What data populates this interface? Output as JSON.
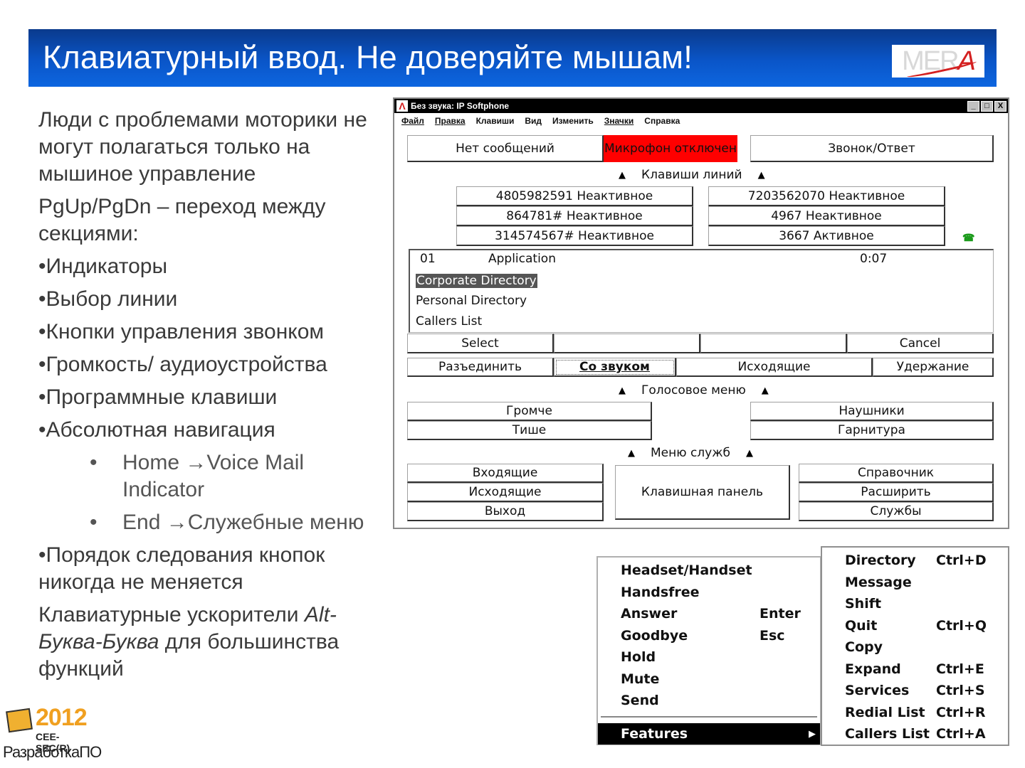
{
  "slide": {
    "title": "Клавиатурный ввод. Не доверяйте мышам!",
    "logo": {
      "text_main": "MER",
      "text_accent": "A"
    },
    "paragraphs": {
      "p1": "Люди с проблемами моторики не могут полагаться только на мышиное управление",
      "p2": "PgUp/PgDn – переход между секциями:",
      "b1": "•Индикаторы",
      "b2": "•Выбор линии",
      "b3": "•Кнопки управления звонком",
      "b4": "•Громкость/ аудиоустройства",
      "b5": "•Программные клавиши",
      "b6": "•Абсолютная навигация",
      "sub1": "Home →Voice Mail Indicator",
      "sub2": "End →Служебные меню",
      "b7": "•Порядок следования кнопок никогда не меняется",
      "p3_pre": "Клавиатурные ускорители ",
      "p3_italic": "Alt-Буква-Буква",
      "p3_post": " для большинства функций"
    },
    "sub_bullet": "•",
    "footer_logo": {
      "year": "2012",
      "name": "CEE-SEC(R)",
      "sub": "РазработкаПО"
    }
  },
  "softphone": {
    "title": "Без звука: IP Softphone",
    "app_icon": "Λ",
    "window_buttons": {
      "minimize": "_",
      "maximize": "□",
      "close": "X"
    },
    "menu": [
      "Файл",
      "Правка",
      "Клавиши",
      "Вид",
      "Изменить",
      "Значки",
      "Справка"
    ],
    "status": {
      "messages": "Нет сообщений",
      "mic": "Микрофон отключен",
      "call": "Звонок/Ответ"
    },
    "sections": {
      "lines": "Клавиши линий",
      "voice": "Голосовое меню",
      "services": "Меню служб"
    },
    "arrow": "▲",
    "lines": [
      "4805982591 Неактивное",
      "7203562070 Неактивное",
      "864781# Неактивное",
      "4967 Неактивное",
      "314574567# Неактивное",
      "3667 Активное"
    ],
    "display": {
      "line_no": "01",
      "app": "Application",
      "timer": "0:07",
      "items": [
        "Corporate Directory",
        "Personal Directory",
        "Callers List"
      ]
    },
    "softkeys": [
      "Select",
      "",
      "",
      "Cancel"
    ],
    "call_buttons": [
      "Разъединить",
      "Со звуком",
      "Исходящие",
      "Удержание"
    ],
    "volume": [
      "Громче",
      "Тише"
    ],
    "audio": [
      "Наушники",
      "Гарнитура"
    ],
    "services_left": [
      "Входящие",
      "Исходящие",
      "Выход"
    ],
    "keypad": "Клавишная панель",
    "services_right": [
      "Справочник",
      "Расширить",
      "Службы"
    ],
    "active_icon": "☎"
  },
  "context_menu": {
    "items": [
      {
        "label": "Headset/Handset",
        "accel": ""
      },
      {
        "label": "Handsfree",
        "accel": ""
      },
      {
        "label": "Answer",
        "accel": "Enter"
      },
      {
        "label": "Goodbye",
        "accel": "Esc"
      },
      {
        "label": "Hold",
        "accel": ""
      },
      {
        "label": "Mute",
        "accel": ""
      },
      {
        "label": "Send",
        "accel": ""
      }
    ],
    "features": "Features",
    "submenu_arrow": "▶"
  },
  "features_menu": {
    "items": [
      {
        "label": "Directory",
        "accel": "Ctrl+D"
      },
      {
        "label": "Message",
        "accel": ""
      },
      {
        "label": "Shift",
        "accel": ""
      },
      {
        "label": "Quit",
        "accel": "Ctrl+Q"
      },
      {
        "label": "Copy",
        "accel": ""
      },
      {
        "label": "Expand",
        "accel": "Ctrl+E"
      },
      {
        "label": "Services",
        "accel": "Ctrl+S"
      },
      {
        "label": "Redial List",
        "accel": "Ctrl+R"
      },
      {
        "label": "Callers List",
        "accel": "Ctrl+A"
      }
    ]
  }
}
